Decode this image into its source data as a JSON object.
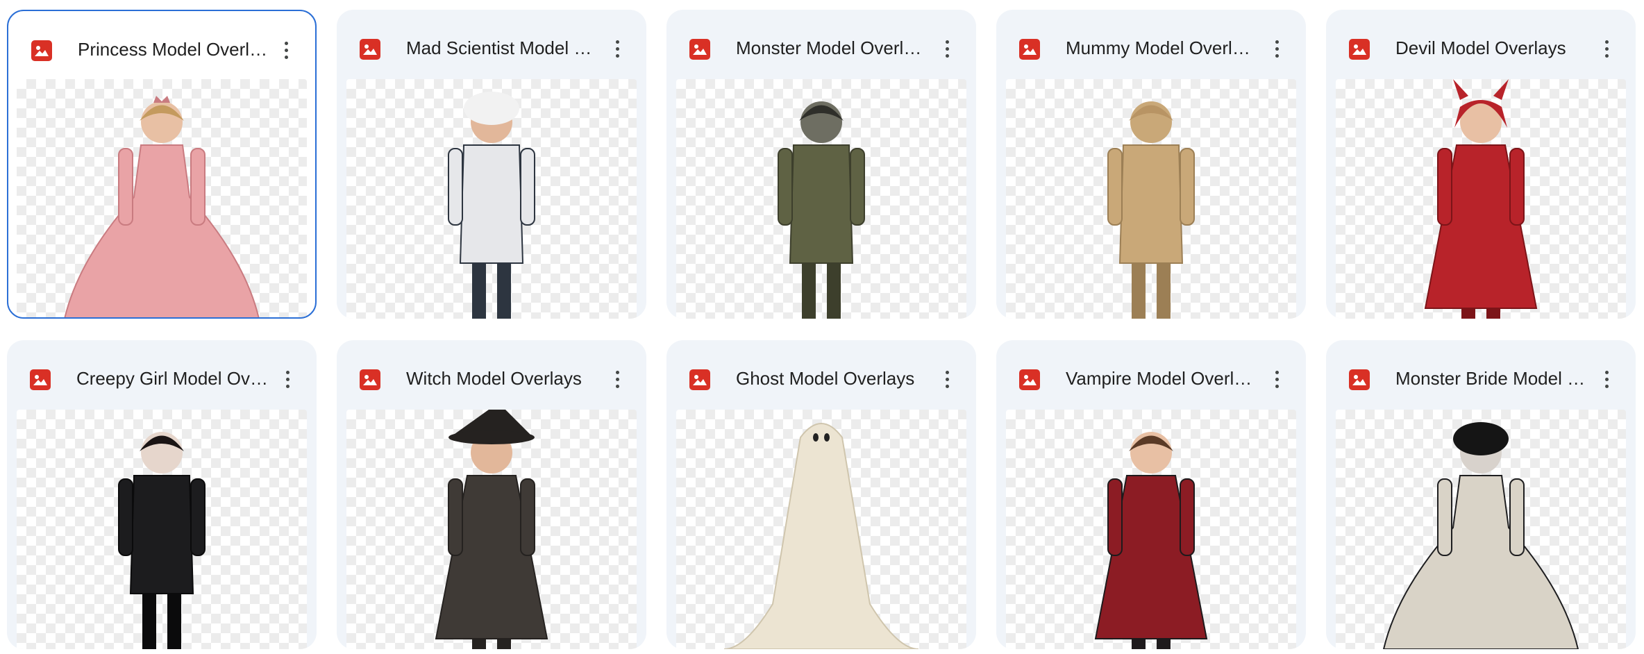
{
  "files": [
    {
      "title": "Princess Model Overlays",
      "icon": "image-file-icon",
      "figure": "princess-figure",
      "colors": {
        "main": "#e9a3a6",
        "dark": "#c97b80",
        "skin": "#e8c0a4",
        "hair": "#c49a5e"
      }
    },
    {
      "title": "Mad Scientist Model Overlays",
      "icon": "image-file-icon",
      "figure": "mad-scientist-figure",
      "colors": {
        "main": "#e6e7ea",
        "dark": "#2d3540",
        "skin": "#e2b79a",
        "hair": "#f2f2f2"
      }
    },
    {
      "title": "Monster Model Overlays",
      "icon": "image-file-icon",
      "figure": "monster-figure",
      "colors": {
        "main": "#5f6244",
        "dark": "#3d3f2c",
        "skin": "#6e6e62",
        "hair": "#2f2f2a"
      }
    },
    {
      "title": "Mummy Model Overlays",
      "icon": "image-file-icon",
      "figure": "mummy-figure",
      "colors": {
        "main": "#c9a878",
        "dark": "#9c7f55",
        "skin": "#c9a878",
        "hair": "#b89464"
      }
    },
    {
      "title": "Devil Model Overlays",
      "icon": "image-file-icon",
      "figure": "devil-figure",
      "colors": {
        "main": "#b8232a",
        "dark": "#7c1418",
        "skin": "#e8c0a4",
        "hair": "#b8232a"
      }
    },
    {
      "title": "Creepy Girl Model Overlays",
      "icon": "image-file-icon",
      "figure": "creepy-girl-figure",
      "colors": {
        "main": "#1c1c1e",
        "dark": "#0b0b0c",
        "skin": "#e6d6cc",
        "hair": "#1a1414"
      }
    },
    {
      "title": "Witch Model Overlays",
      "icon": "image-file-icon",
      "figure": "witch-figure",
      "colors": {
        "main": "#3f3a36",
        "dark": "#252220",
        "skin": "#e2b79a",
        "hair": "#6b4a32"
      }
    },
    {
      "title": "Ghost Model Overlays",
      "icon": "image-file-icon",
      "figure": "ghost-figure",
      "colors": {
        "main": "#ece4d2",
        "dark": "#cfc5ad",
        "skin": "#ece4d2",
        "hair": "#ece4d2"
      }
    },
    {
      "title": "Vampire Model Overlays",
      "icon": "image-file-icon",
      "figure": "vampire-figure",
      "colors": {
        "main": "#8c1c24",
        "dark": "#1e1a1c",
        "skin": "#e8c0a4",
        "hair": "#5a3a26"
      }
    },
    {
      "title": "Monster Bride Model Overlays",
      "icon": "image-file-icon",
      "figure": "monster-bride-figure",
      "colors": {
        "main": "#d9d3c7",
        "dark": "#1e1e20",
        "skin": "#d8d2cc",
        "hair": "#151515"
      }
    }
  ],
  "selected_index": 0,
  "menu_icon": "more-vert-icon"
}
